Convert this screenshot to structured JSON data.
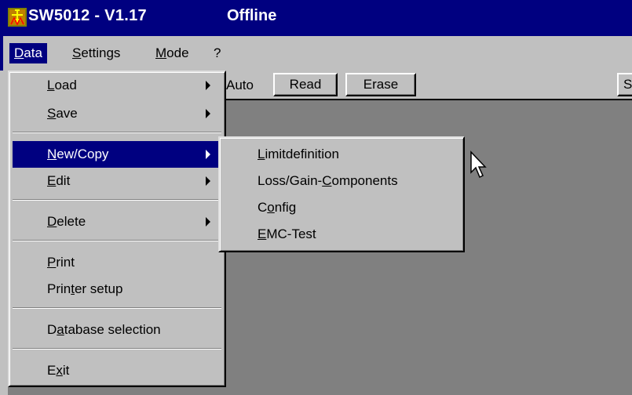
{
  "titlebar": {
    "title": "SW5012 - V1.17",
    "status": "Offline",
    "icon": "app-logo-icon"
  },
  "menubar": {
    "items": [
      {
        "pre": "",
        "key": "D",
        "post": "ata"
      },
      {
        "pre": "",
        "key": "S",
        "post": "ettings"
      },
      {
        "pre": "",
        "key": "M",
        "post": "ode"
      },
      {
        "pre": "",
        "key": "",
        "post": "?"
      }
    ]
  },
  "toolbar": {
    "auto_label": "Auto",
    "read_label": "Read",
    "erase_label": "Erase",
    "right_label": "S"
  },
  "data_menu": {
    "items": [
      {
        "pre": "",
        "key": "L",
        "post": "oad"
      },
      {
        "pre": "",
        "key": "S",
        "post": "ave"
      },
      {
        "pre": "",
        "key": "N",
        "post": "ew/Copy"
      },
      {
        "pre": "",
        "key": "E",
        "post": "dit"
      },
      {
        "pre": "",
        "key": "D",
        "post": "elete"
      },
      {
        "pre": "",
        "key": "P",
        "post": "rint"
      },
      {
        "pre": "Prin",
        "key": "t",
        "post": "er setup"
      },
      {
        "pre": "D",
        "key": "a",
        "post": "tabase selection"
      },
      {
        "pre": "E",
        "key": "x",
        "post": "it"
      }
    ]
  },
  "newcopy_submenu": {
    "items": [
      {
        "pre": "",
        "key": "L",
        "post": "imitdefinition"
      },
      {
        "pre": "Loss/Gain-",
        "key": "C",
        "post": "omponents"
      },
      {
        "pre": "C",
        "key": "o",
        "post": "nfig"
      },
      {
        "pre": "",
        "key": "E",
        "post": "MC-Test"
      }
    ]
  },
  "colors": {
    "titlebar_bg": "#000080",
    "face": "#c0c0c0",
    "client_bg": "#808080",
    "highlight": "#000080"
  }
}
